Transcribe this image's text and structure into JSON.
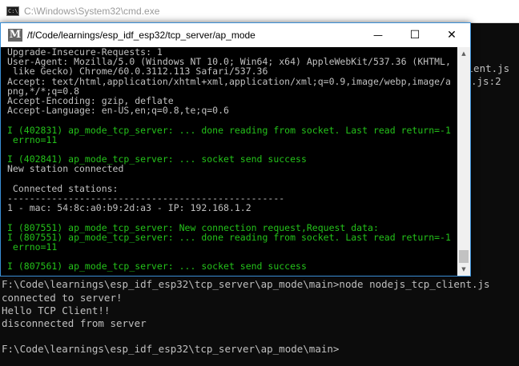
{
  "cmd": {
    "icon_text": "C:\\",
    "title": "C:\\Windows\\System32\\cmd.exe",
    "top_fragments": [
      "M",
      "(",
      "F",
      "c",
      "s"
    ],
    "right_fragments": [
      "lient.js",
      ".js:2"
    ],
    "output": [
      "F:\\Code\\learnings\\esp_idf_esp32\\tcp_server\\ap_mode\\main>node nodejs_tcp_client.js",
      "connected to server!",
      "Hello TCP Client!!",
      "disconnected from server",
      "",
      "F:\\Code\\learnings\\esp_idf_esp32\\tcp_server\\ap_mode\\main>"
    ]
  },
  "mintty": {
    "icon": "M",
    "title": "/f/Code/learnings/esp_idf_esp32/tcp_server/ap_mode",
    "minimize_symbol": "—",
    "maximize_symbol": "☐",
    "close_symbol": "✕",
    "scroll_up_symbol": "▲",
    "scroll_down_symbol": "▼",
    "lines": [
      {
        "text": "Upgrade-Insecure-Requests: 1",
        "color": "white"
      },
      {
        "text": "User-Agent: Mozilla/5.0 (Windows NT 10.0; Win64; x64) AppleWebKit/537.36 (KHTML,",
        "color": "white"
      },
      {
        "text": " like Gecko) Chrome/60.0.3112.113 Safari/537.36",
        "color": "white"
      },
      {
        "text": "Accept: text/html,application/xhtml+xml,application/xml;q=0.9,image/webp,image/a",
        "color": "white"
      },
      {
        "text": "png,*/*;q=0.8",
        "color": "white"
      },
      {
        "text": "Accept-Encoding: gzip, deflate",
        "color": "white"
      },
      {
        "text": "Accept-Language: en-US,en;q=0.8,te;q=0.6",
        "color": "white"
      },
      {
        "text": "",
        "color": "white"
      },
      {
        "text": "I (402831) ap_mode_tcp_server: ... done reading from socket. Last read return=-1",
        "color": "green"
      },
      {
        "text": " errno=11",
        "color": "green"
      },
      {
        "text": "",
        "color": "white"
      },
      {
        "text": "I (402841) ap_mode_tcp_server: ... socket send success",
        "color": "green"
      },
      {
        "text": "New station connected",
        "color": "white"
      },
      {
        "text": "",
        "color": "white"
      },
      {
        "text": " Connected stations:",
        "color": "white"
      },
      {
        "text": "--------------------------------------------------",
        "color": "white"
      },
      {
        "text": "1 - mac: 54:8c:a0:b9:2d:a3 - IP: 192.168.1.2",
        "color": "white"
      },
      {
        "text": "",
        "color": "white"
      },
      {
        "text": "I (807551) ap_mode_tcp_server: New connection request,Request data:",
        "color": "green"
      },
      {
        "text": "I (807551) ap_mode_tcp_server: ... done reading from socket. Last read return=-1",
        "color": "green"
      },
      {
        "text": " errno=11",
        "color": "green"
      },
      {
        "text": "",
        "color": "white"
      },
      {
        "text": "I (807561) ap_mode_tcp_server: ... socket send success",
        "color": "green"
      }
    ]
  }
}
